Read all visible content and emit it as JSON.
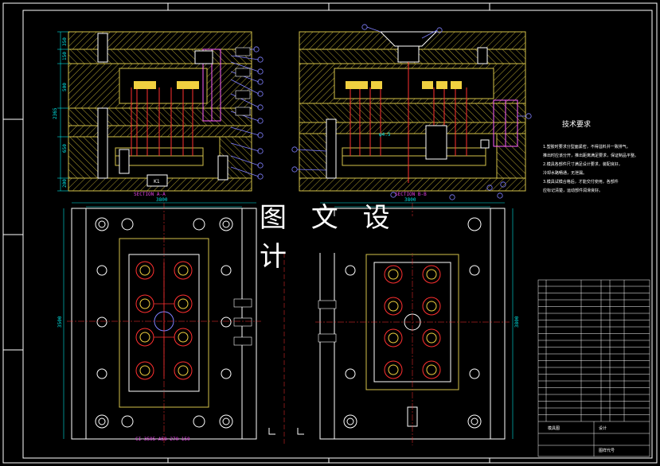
{
  "overlay_title": "图 文 设 计",
  "tech_requirements": {
    "title": "技术要求",
    "notes": [
      "1.塑胶时要求分型面紧密，不得溢料并一致排气。",
      "  推出时应该分开，推出距离满足要求，保证制品平整。",
      "2.模具各部件尺寸满足设计要求，装配良好，",
      "  冷却水路畅通，无泄漏。",
      "3.模具试模合格后，才能交付使用，各部件",
      "  应标记清楚，运动部件润滑良好。"
    ]
  },
  "dimensions": {
    "left_overall_height": "2365",
    "left_top_a": "350",
    "left_top_b": "150",
    "left_mid": "500",
    "left_low": "650",
    "left_bottom": "200",
    "plan_width_outer": "3800",
    "plan_width_inner": "3500",
    "plan_height_left": "3500",
    "plan_height_right": "3800",
    "section_note": "φ4.5"
  },
  "captions": {
    "left_section": "SECTION A-A",
    "right_section": "SECTION B-B",
    "plan_bottom_left": "CI-3505-A50-270-150"
  },
  "title_block": {
    "project": "模具图",
    "designer": "设计",
    "sheet": "图样代号"
  },
  "colors": {
    "background": "#000000",
    "frame": "#ffffff",
    "mold_plate": "#d4c24a",
    "hatch": "#b0a030",
    "runner": "#ff3030",
    "cooling": "#30c0ff",
    "dimension": "#00e5e5",
    "balloon": "#8080ff",
    "green": "#30ff30"
  }
}
